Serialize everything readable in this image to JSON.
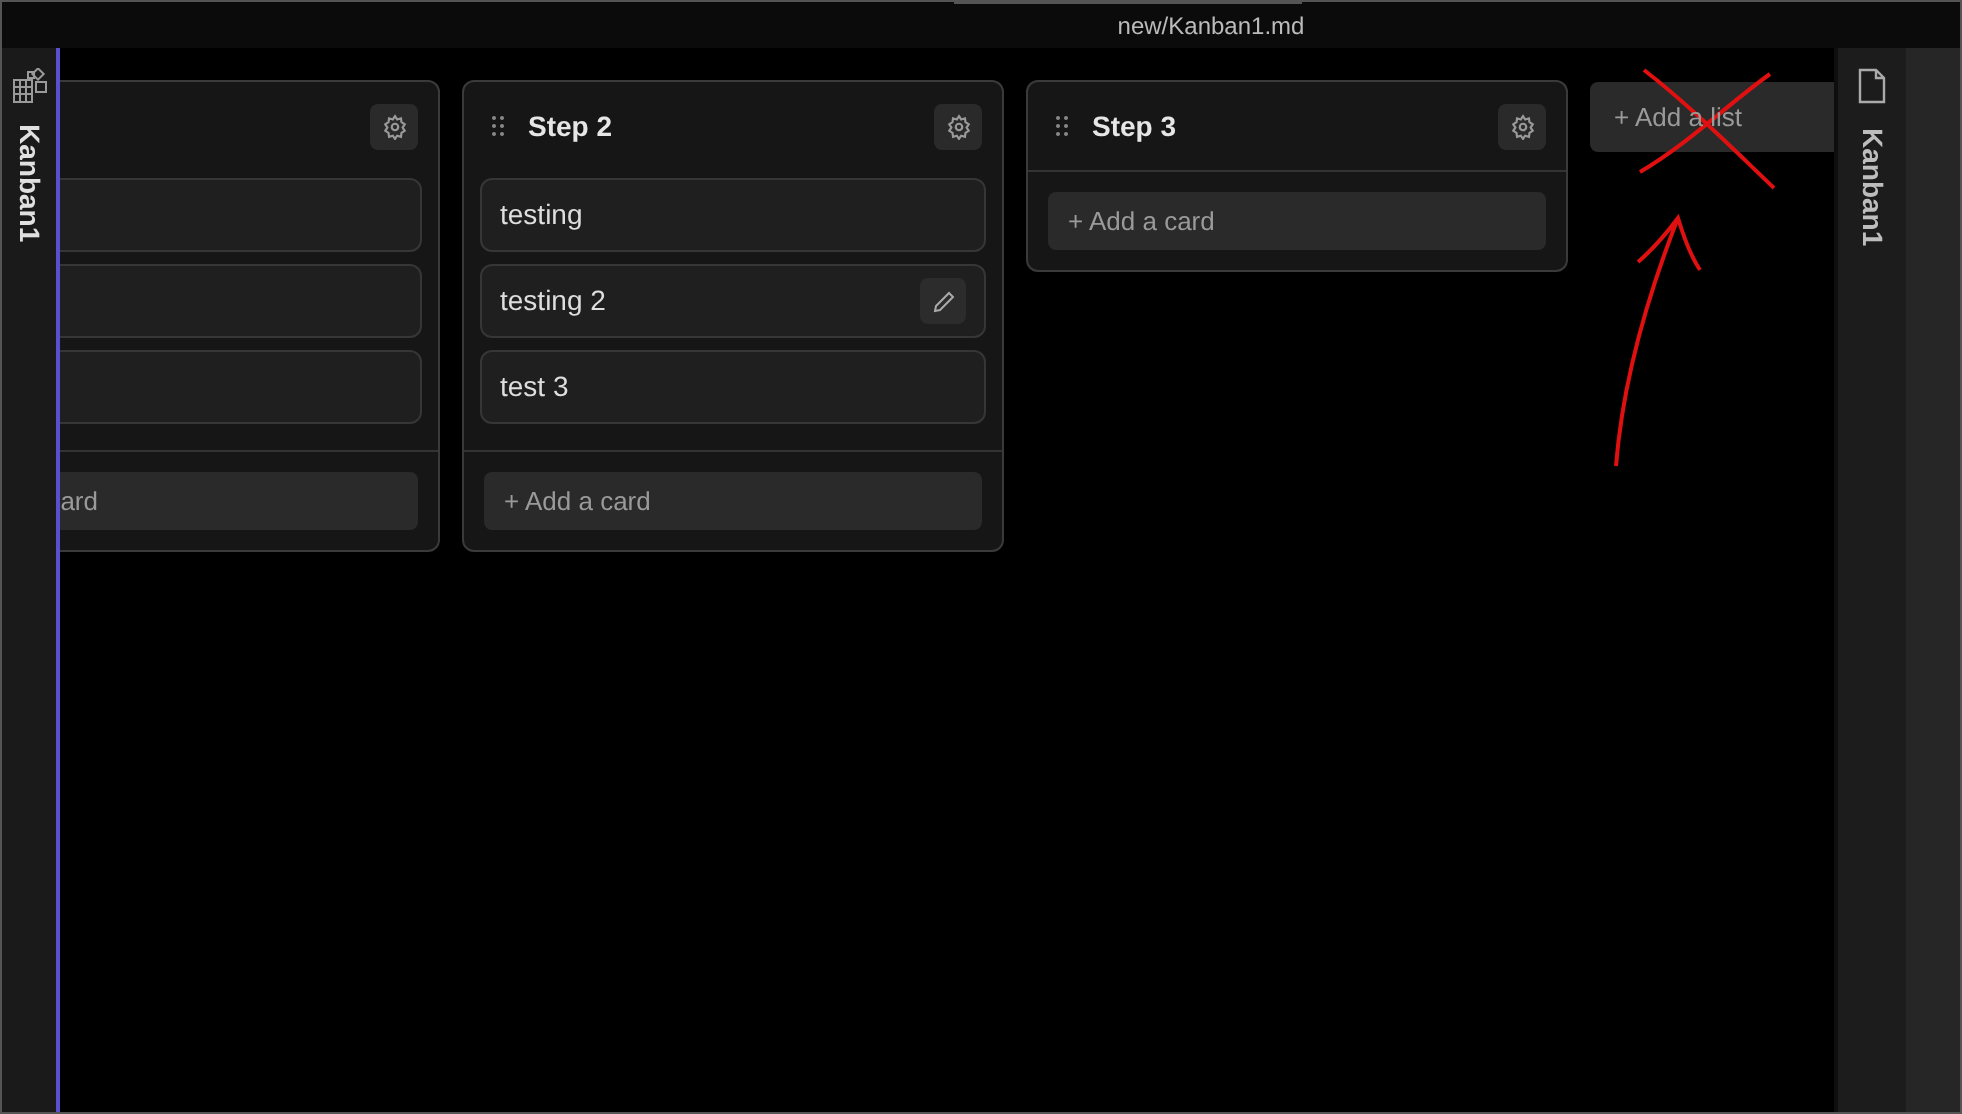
{
  "window": {
    "title": "new/Kanban1.md"
  },
  "left_sidebar": {
    "label": "Kanban1"
  },
  "lists": [
    {
      "cards": [
        {
          "hovered": false
        },
        {
          "hovered": false
        },
        {
          "hovered": false
        }
      ],
      "add_card": "ard"
    },
    {
      "title": "Step 2",
      "cards": [
        {
          "text": "testing",
          "hovered": false
        },
        {
          "text": "testing 2",
          "hovered": true
        },
        {
          "text": "test 3",
          "hovered": false
        }
      ],
      "add_card": "+ Add a card"
    },
    {
      "title": "Step 3",
      "add_card": "+ Add a card"
    }
  ],
  "add_list": "+ Add a list",
  "right_sidebar": {
    "label": "Kanban1"
  }
}
